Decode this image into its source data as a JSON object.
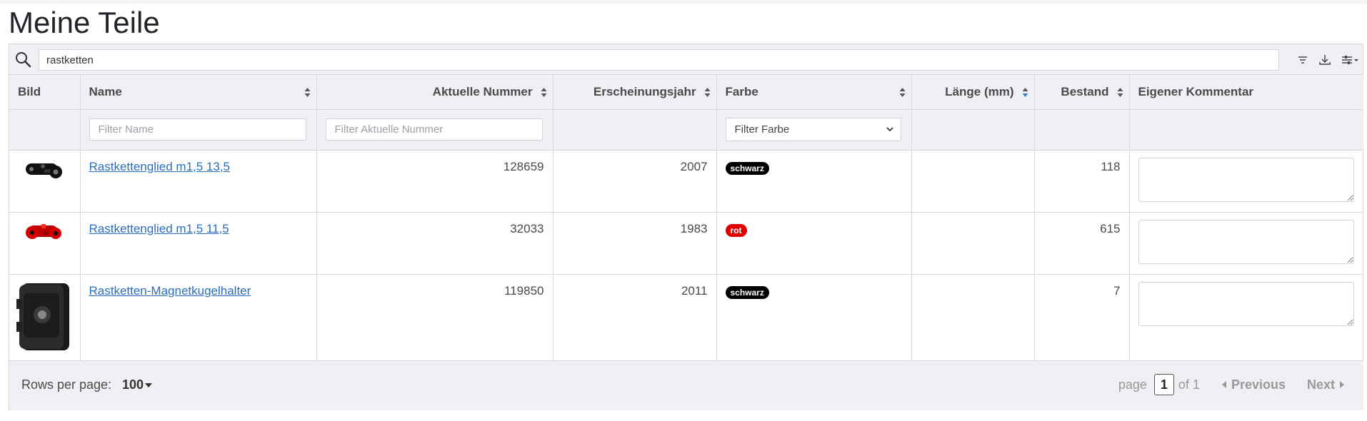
{
  "page": {
    "title": "Meine Teile"
  },
  "toolbar": {
    "search_value": "rastketten",
    "icons": [
      "search-icon",
      "filter-icon",
      "download-icon",
      "column-settings-icon"
    ]
  },
  "table": {
    "columns": [
      "Bild",
      "Name",
      "Aktuelle Nummer",
      "Erscheinungsjahr",
      "Farbe",
      "Länge (mm)",
      "Bestand",
      "Eigener Kommentar"
    ],
    "filters": {
      "name_placeholder": "Filter Name",
      "nummer_placeholder": "Filter Aktuelle Nummer",
      "farbe_selected": "Filter Farbe"
    },
    "rows": [
      {
        "name": "Rastkettenglied m1,5 13,5",
        "nummer": "128659",
        "jahr": "2007",
        "farbe": "schwarz",
        "farbe_color": "#000000",
        "laenge": "",
        "bestand": "118",
        "kommentar": ""
      },
      {
        "name": "Rastkettenglied m1,5 11,5",
        "nummer": "32033",
        "jahr": "1983",
        "farbe": "rot",
        "farbe_color": "#e00000",
        "laenge": "",
        "bestand": "615",
        "kommentar": ""
      },
      {
        "name": "Rastketten-Magnetkugelhalter",
        "nummer": "119850",
        "jahr": "2011",
        "farbe": "schwarz",
        "farbe_color": "#000000",
        "laenge": "",
        "bestand": "7",
        "kommentar": ""
      }
    ]
  },
  "footer": {
    "rows_label": "Rows per page:",
    "rows_value": "100",
    "page_label": "page",
    "page_current": "1",
    "page_of": "of 1",
    "prev_label": "Previous",
    "next_label": "Next"
  },
  "colors": {
    "link": "#2a6ebb",
    "header_bg": "#eef0f3",
    "active_sort": "#3b82c4"
  }
}
